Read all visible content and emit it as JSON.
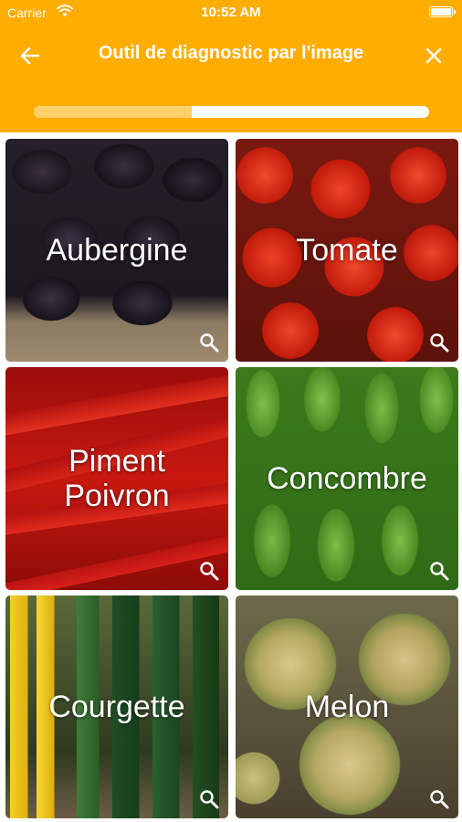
{
  "status_bar": {
    "carrier": "Carrier",
    "time": "10:52 AM",
    "battery_level": 1.0
  },
  "nav": {
    "title": "Outil de diagnostic par l'image",
    "back_icon": "arrow-left-icon",
    "close_icon": "close-icon"
  },
  "progress": {
    "value": 0.4
  },
  "colors": {
    "header": "#FFAD00",
    "progress_track": "#FFFFFF",
    "progress_fill": "#FFD06A"
  },
  "tiles": [
    {
      "label": "Aubergine",
      "icon": "search-icon"
    },
    {
      "label": "Tomate",
      "icon": "search-icon"
    },
    {
      "label": "Piment\nPoivron",
      "icon": "search-icon"
    },
    {
      "label": "Concombre",
      "icon": "search-icon"
    },
    {
      "label": "Courgette",
      "icon": "search-icon"
    },
    {
      "label": "Melon",
      "icon": "search-icon"
    }
  ]
}
